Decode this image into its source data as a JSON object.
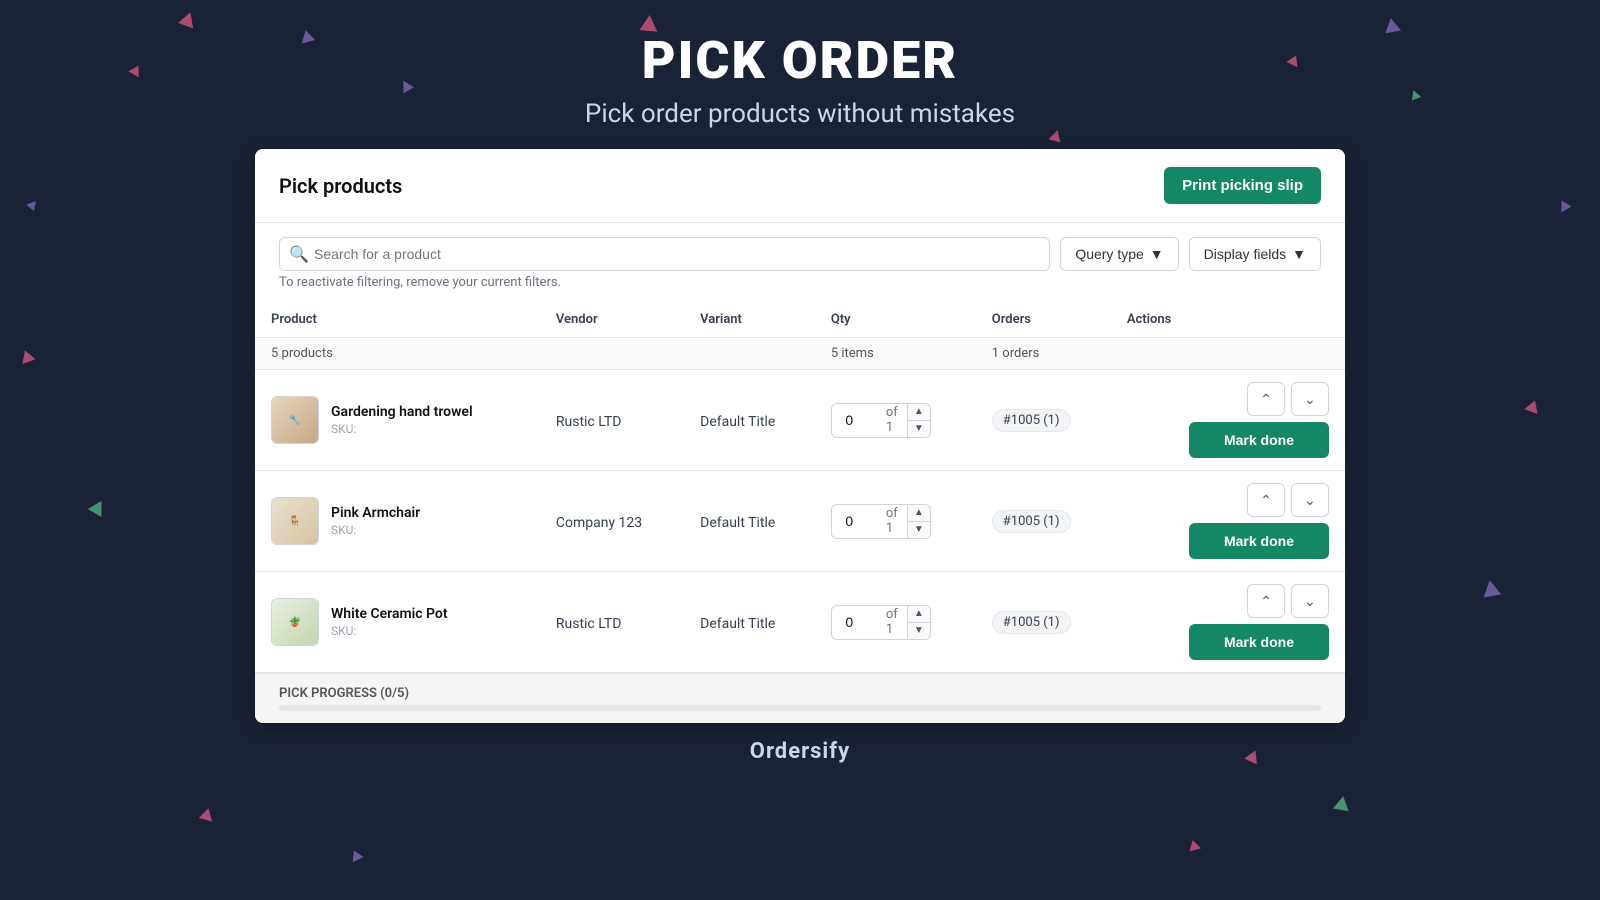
{
  "page": {
    "title": "PICK ORDER",
    "subtitle": "Pick order products without mistakes",
    "footer": "Ordersify"
  },
  "card": {
    "title": "Pick products",
    "print_btn": "Print picking slip"
  },
  "search": {
    "placeholder": "Search for a product",
    "filter_hint": "To reactivate filtering, remove your current filters.",
    "query_type_label": "Query type",
    "display_fields_label": "Display fields"
  },
  "table": {
    "columns": [
      "Product",
      "Vendor",
      "Variant",
      "Qty",
      "Orders",
      "Actions"
    ],
    "summary": {
      "products_count": "5 products",
      "qty_items": "5 items",
      "orders_count": "1 orders"
    },
    "rows": [
      {
        "name": "Gardening hand trowel",
        "sku": "SKU:",
        "vendor": "Rustic LTD",
        "variant": "Default Title",
        "qty_val": "0",
        "qty_of": "of 1",
        "orders": "#1005 (1)",
        "img_type": "trowel"
      },
      {
        "name": "Pink Armchair",
        "sku": "SKU:",
        "vendor": "Company 123",
        "variant": "Default Title",
        "qty_val": "0",
        "qty_of": "of 1",
        "orders": "#1005 (1)",
        "img_type": "chair"
      },
      {
        "name": "White Ceramic Pot",
        "sku": "SKU:",
        "vendor": "Rustic LTD",
        "variant": "Default Title",
        "qty_val": "0",
        "qty_of": "of 1",
        "orders": "#1005 (1)",
        "img_type": "pot"
      }
    ],
    "mark_done_label": "Mark done"
  },
  "progress": {
    "label": "PICK PROGRESS (0/5)",
    "percent": 0
  }
}
